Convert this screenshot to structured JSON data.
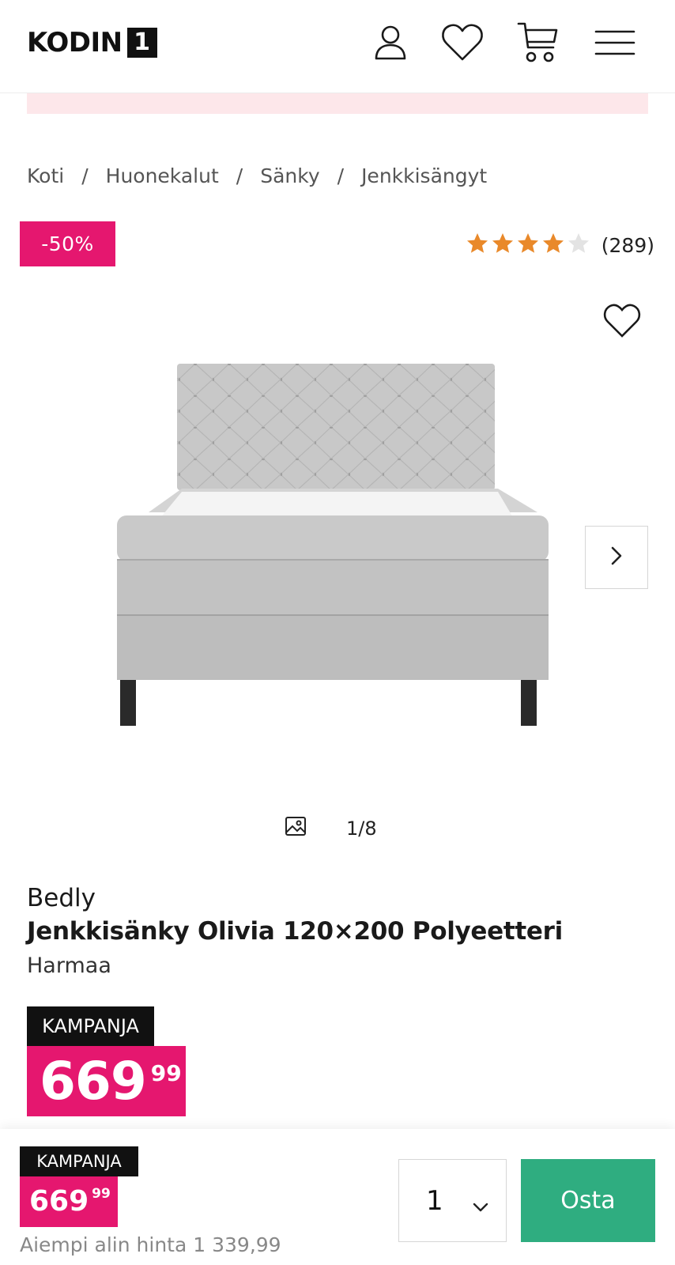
{
  "header": {
    "logo_text": "KODIN",
    "logo_box": "1",
    "icons": [
      "user-icon",
      "heart-icon",
      "cart-icon",
      "menu-icon"
    ]
  },
  "breadcrumb": {
    "items": [
      "Koti",
      "Huonekalut",
      "Sänky",
      "Jenkkisängyt"
    ],
    "separator": "/"
  },
  "badge": {
    "discount": "-50%"
  },
  "rating": {
    "stars": 4,
    "max": 5,
    "count": "(289)"
  },
  "gallery": {
    "counter": "1/8",
    "image_icon": "image-icon"
  },
  "product": {
    "brand": "Bedly",
    "title": "Jenkkisänky Olivia 120×200 Polyeetteri",
    "color": "Harmaa"
  },
  "price": {
    "tag": "KAMPANJA",
    "main": "669",
    "decimals": "99"
  },
  "sticky_bar": {
    "tag": "KAMPANJA",
    "price_main": "669",
    "price_decimals": "99",
    "lowest_price": "Aiempi alin hinta 1 339,99",
    "quantity": "1",
    "buy_label": "Osta"
  },
  "colors": {
    "accent_pink": "#e5176f",
    "buy_green": "#2fad80",
    "star_orange": "#e9892a",
    "promo_strip": "#fde7ea"
  }
}
